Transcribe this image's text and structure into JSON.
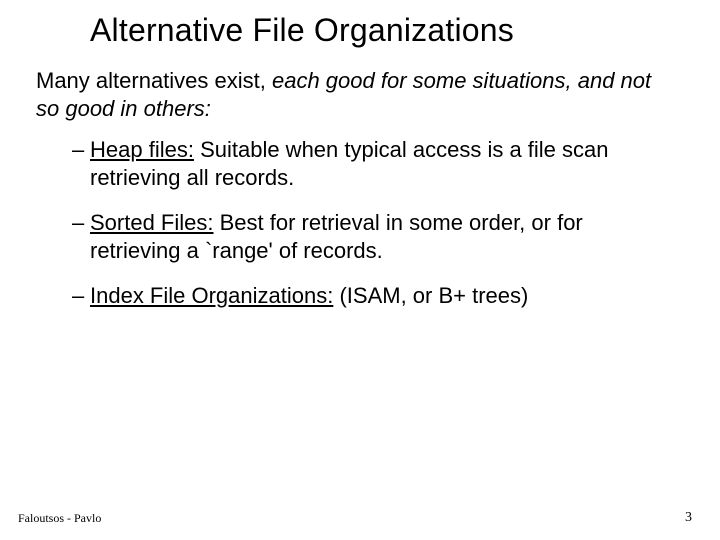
{
  "title": "Alternative File Organizations",
  "intro": {
    "plain": "Many alternatives exist, ",
    "italic": "each good for some situations, and not so good in others:"
  },
  "bullets": [
    {
      "label": "Heap files:",
      "rest": "  Suitable when typical access is a file scan retrieving all records."
    },
    {
      "label": "Sorted Files:",
      "rest": "  Best for retrieval in some order, or for retrieving a `range' of records."
    },
    {
      "label": "Index File Organizations:",
      "rest": " (ISAM, or B+ trees)"
    }
  ],
  "footer": {
    "left": "Faloutsos - Pavlo",
    "right": "3"
  },
  "dash": "–"
}
